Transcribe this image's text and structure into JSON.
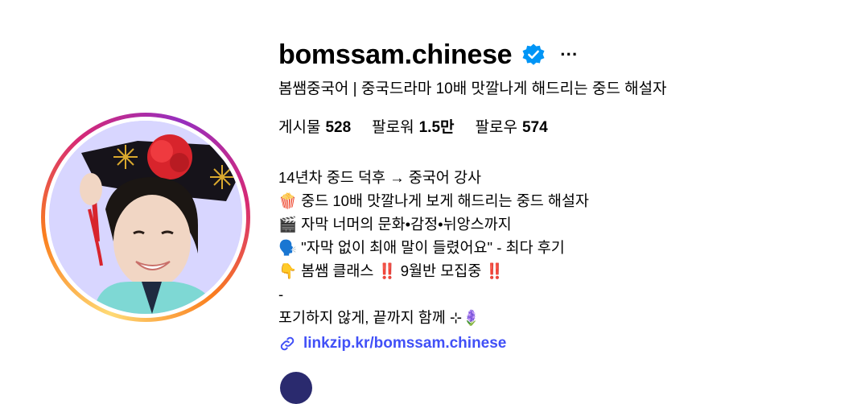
{
  "profile": {
    "username": "bomssam.chinese",
    "verified_icon": "verified-badge-icon",
    "more_label": "···",
    "full_name": "봄쌤중국어 | 중국드라마 10배 맛깔나게 해드리는 중드 해설자",
    "stats": {
      "posts_label": "게시물",
      "posts_value": "528",
      "followers_label": "팔로워",
      "followers_value": "1.5만",
      "following_label": "팔로우",
      "following_value": "574"
    },
    "bio": {
      "line1": "14년차 중드 덕후 → 중국어 강사",
      "line2": "🍿 중드 10배 맛깔나게 보게 해드리는 중드 해설자",
      "line3": "🎬 자막 너머의 문화•감정•뉘앙스까지",
      "line4": "🗣️ \"자막 없이 최애 말이 들렸어요\" - 최다 후기",
      "line5_prefix": "👇 봄쌤 클래스 ",
      "line5_mark1": "‼️",
      "line5_mid": " 9월반 모집중 ",
      "line5_mark2": "‼️",
      "line6": "-",
      "line7": "포기하지 않게, 끝까지 함께 ⊹🪻"
    },
    "link": {
      "icon": "link-icon",
      "text": "linkzip.kr/bomssam.chinese"
    }
  },
  "colors": {
    "link": "#4150f7",
    "verified": "#0095f6",
    "avatar_bg": "#d8d6ff"
  }
}
